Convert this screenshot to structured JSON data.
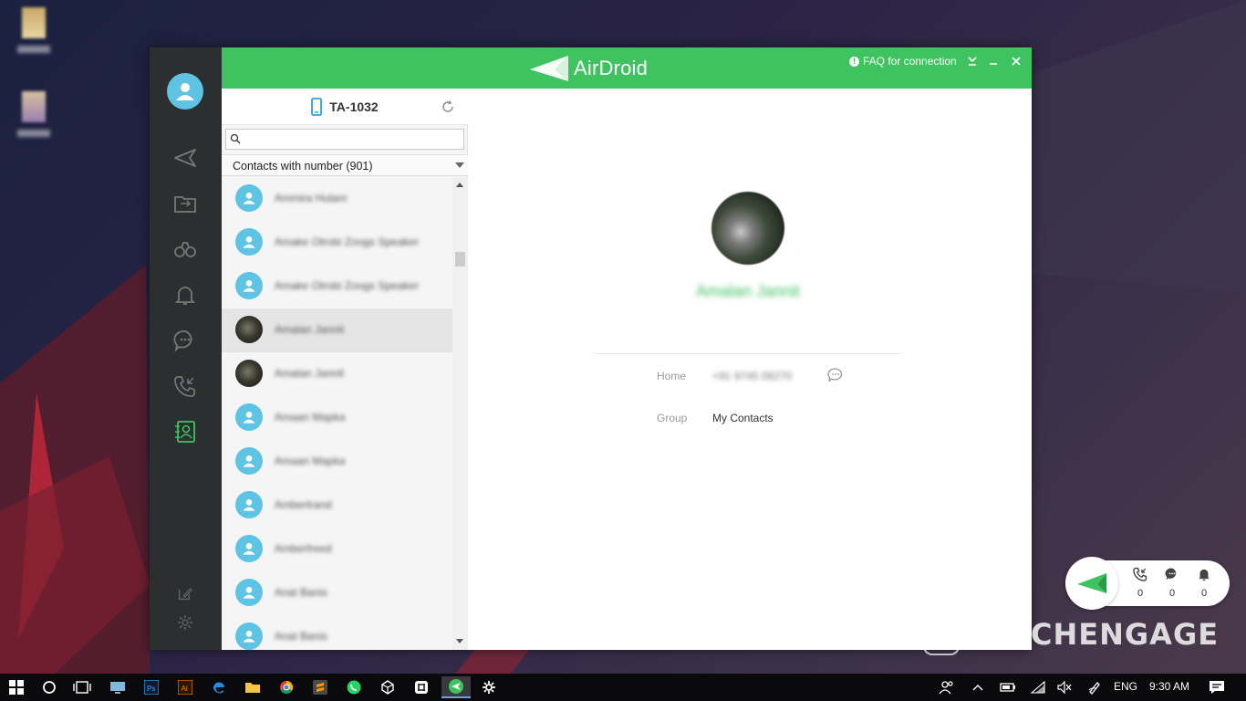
{
  "app": {
    "name": "AirDroid",
    "faq_label": "FAQ for connection",
    "device_name": "TA-1032",
    "search": {
      "value": "",
      "placeholder": ""
    },
    "filter_label": "Contacts with number (901)",
    "contacts": [
      {
        "name": "Ammira Hulam",
        "photo": false,
        "selected": false
      },
      {
        "name": "Amake Otrobi Zoogs Speaker",
        "photo": false,
        "selected": false
      },
      {
        "name": "Amake Otrobi Zoogs Speaker",
        "photo": false,
        "selected": false
      },
      {
        "name": "Amalan Jannit",
        "photo": true,
        "selected": true
      },
      {
        "name": "Amalan Jannit",
        "photo": true,
        "selected": false
      },
      {
        "name": "Amaan Mapka",
        "photo": false,
        "selected": false
      },
      {
        "name": "Amaan Mapka",
        "photo": false,
        "selected": false
      },
      {
        "name": "Ambertrand",
        "photo": false,
        "selected": false
      },
      {
        "name": "Amberfreed",
        "photo": false,
        "selected": false
      },
      {
        "name": "Anat Banis",
        "photo": false,
        "selected": false
      },
      {
        "name": "Anat Banis",
        "photo": false,
        "selected": false
      }
    ],
    "detail": {
      "name": "Amalan Jannit",
      "phone_label": "Home",
      "phone_value": "+91 9745 08270",
      "group_label": "Group",
      "group_value": "My Contacts"
    }
  },
  "widget": {
    "calls": "0",
    "messages": "0",
    "notifications": "0"
  },
  "watermark": "CHENGAGE",
  "taskbar": {
    "language": "ENG",
    "time": "9:30 AM"
  },
  "colors": {
    "accent": "#3fc360",
    "rail": "#2c2f30",
    "avatar": "#5fc3e4"
  }
}
